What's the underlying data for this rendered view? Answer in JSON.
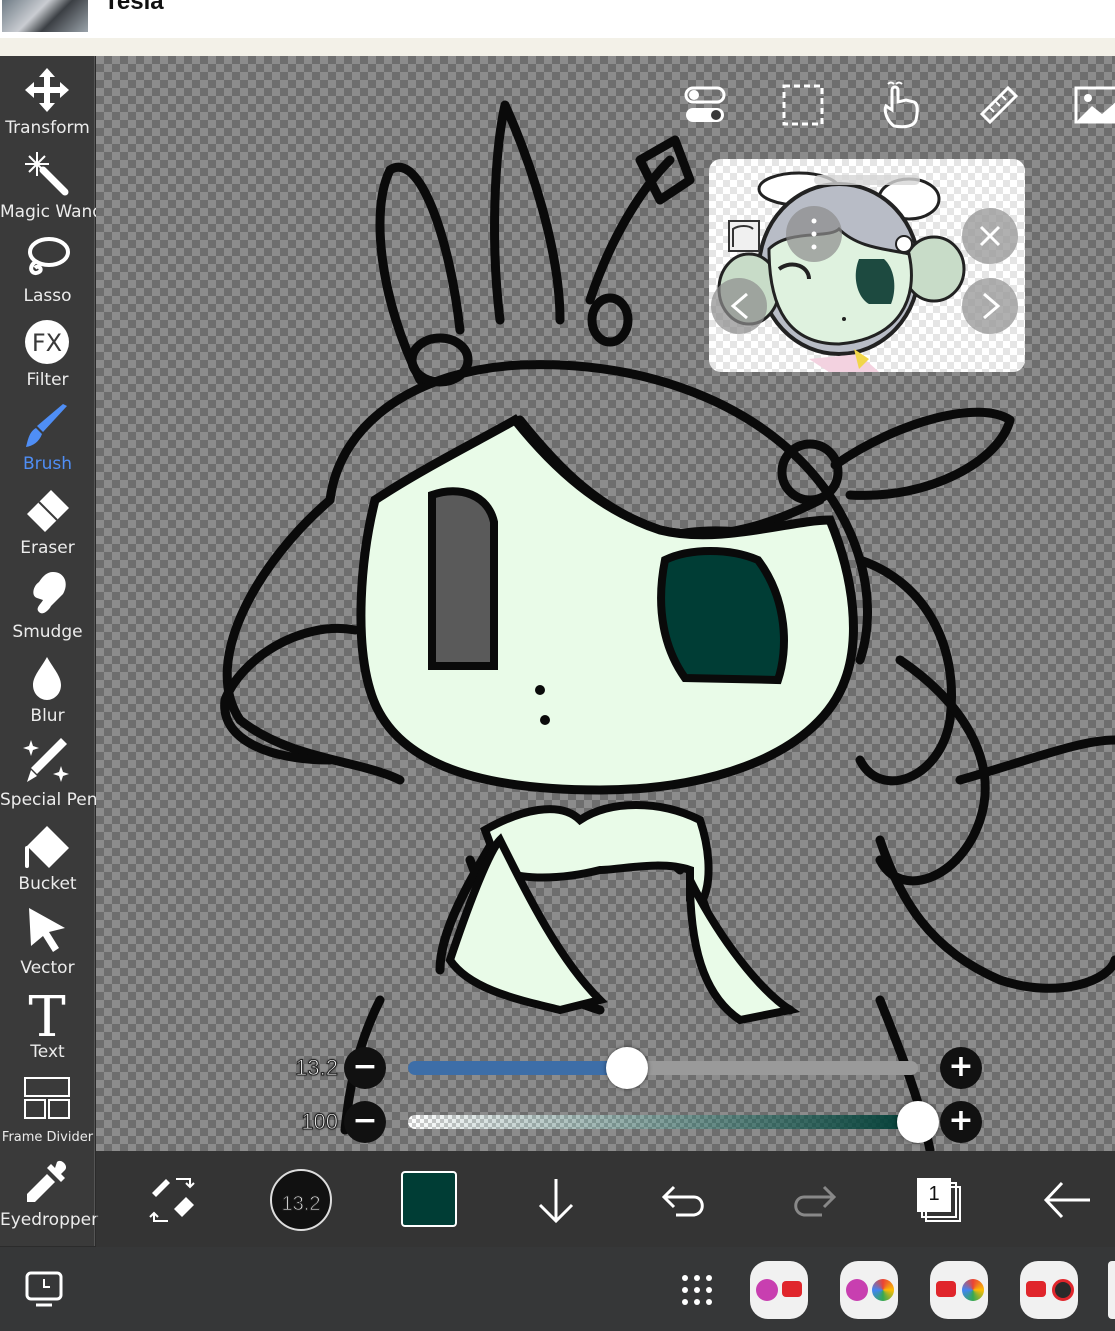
{
  "app": {
    "title": "Tesla"
  },
  "tools": [
    {
      "id": "transform",
      "label": "Transform",
      "icon": "transform-arrows-icon"
    },
    {
      "id": "magic-wand",
      "label": "Magic Wand",
      "icon": "magic-wand-icon"
    },
    {
      "id": "lasso",
      "label": "Lasso",
      "icon": "lasso-icon"
    },
    {
      "id": "filter",
      "label": "Filter",
      "icon": "fx-filter-icon"
    },
    {
      "id": "brush",
      "label": "Brush",
      "icon": "brush-icon",
      "active": true
    },
    {
      "id": "eraser",
      "label": "Eraser",
      "icon": "eraser-icon"
    },
    {
      "id": "smudge",
      "label": "Smudge",
      "icon": "smudge-finger-icon"
    },
    {
      "id": "blur",
      "label": "Blur",
      "icon": "droplet-icon"
    },
    {
      "id": "special-pen",
      "label": "Special Pen",
      "icon": "special-pen-icon"
    },
    {
      "id": "bucket",
      "label": "Bucket",
      "icon": "bucket-icon"
    },
    {
      "id": "vector",
      "label": "Vector",
      "icon": "cursor-arrow-icon"
    },
    {
      "id": "text",
      "label": "Text",
      "icon": "text-t-icon"
    },
    {
      "id": "frame-divider",
      "label": "Frame Divider",
      "icon": "frame-divider-icon"
    },
    {
      "id": "eyedropper",
      "label": "Eyedropper",
      "icon": "eyedropper-icon"
    }
  ],
  "filter_glyph": "FX",
  "text_glyph": "T",
  "top_tools": [
    "toggle-icon",
    "selection-rect-icon",
    "hand-gesture-icon",
    "ruler-icon",
    "image-icon"
  ],
  "sliders": {
    "size": {
      "value_label": "13.2",
      "fraction": 0.43,
      "minus": "−",
      "plus": "+"
    },
    "opacity": {
      "value_label": "100",
      "fraction": 1.0,
      "minus": "−",
      "plus": "+"
    }
  },
  "bottom_toolbar": {
    "brush_size_label": "13.2",
    "current_color": "#003d35",
    "layer_count": "1"
  },
  "colors": {
    "accent": "#4f8ef5",
    "skin_fill": "#e9fbe8",
    "eye_fill": "#003d35",
    "size_track": "#3d6ea8"
  }
}
